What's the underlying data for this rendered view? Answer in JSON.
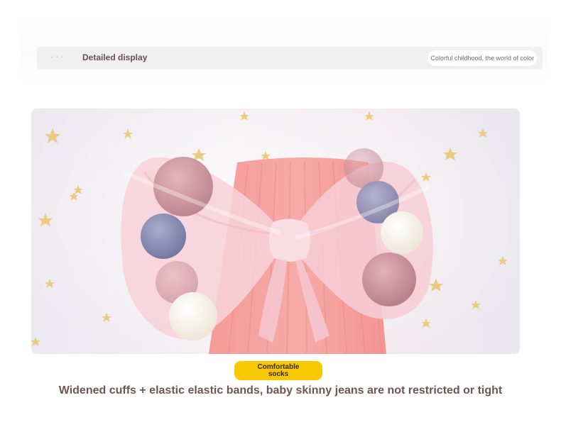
{
  "header": {
    "prefix": "• • •",
    "title": "Detailed display",
    "tagline": "Colorful childhood, the world of color"
  },
  "product_image": {
    "subject": "pink-socks-with-bow",
    "colors": {
      "sock": "#f4a3a1",
      "bow": "#f6cfd8",
      "pompom_pink": "#c98e98",
      "pompom_blue": "#8a8fb5",
      "pompom_cream": "#f7f3ea",
      "star": "#e8c26a"
    }
  },
  "badge": {
    "label": "Comfortable socks",
    "color": "#f8c800"
  },
  "caption": "Widened cuffs + elastic elastic bands, baby skinny jeans are not restricted or tight"
}
